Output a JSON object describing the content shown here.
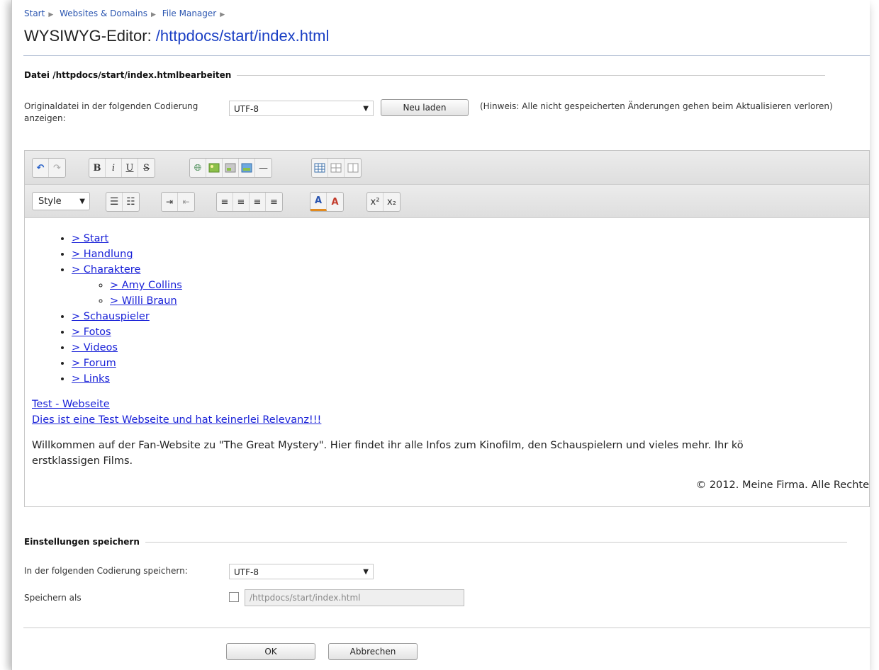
{
  "breadcrumb": [
    "Start",
    "Websites & Domains",
    "File Manager"
  ],
  "title": {
    "prefix": "WYSIWYG-Editor: ",
    "path": "/httpdocs/start/index.html"
  },
  "edit_section": {
    "title_prefix": "Datei /httpdocs/start/index.html ",
    "title_bold": "bearbeiten",
    "encoding_label": "Originaldatei in der folgenden Codierung anzeigen:",
    "encoding_value": "UTF-8",
    "reload_button": "Neu laden",
    "hint": "(Hinweis: Alle nicht gespeicherten Änderungen gehen beim Aktualisieren verloren)"
  },
  "toolbar": {
    "style_select": "Style"
  },
  "editor_content": {
    "nav": [
      {
        "label": "> Start"
      },
      {
        "label": "> Handlung"
      },
      {
        "label": "> Charaktere",
        "children": [
          "> Amy Collins",
          "> Willi Braun"
        ]
      },
      {
        "label": "> Schauspieler"
      },
      {
        "label": "> Fotos"
      },
      {
        "label": "> Videos"
      },
      {
        "label": "> Forum"
      },
      {
        "label": "> Links"
      }
    ],
    "link1": "Test - Webseite",
    "link2": "Dies ist eine Test Webseite und hat keinerlei Relevanz!!!",
    "welcome_line1": "Willkommen auf der Fan-Website zu \"The Great Mystery\". Hier findet ihr alle Infos zum Kinofilm, den Schauspielern und vieles mehr. Ihr kö",
    "welcome_line2": "erstklassigen Films.",
    "copyright": "© 2012. Meine Firma. Alle Rechte"
  },
  "save_section": {
    "title": "Einstellungen speichern",
    "encoding_label": "In der folgenden Codierung speichern:",
    "encoding_value": "UTF-8",
    "save_as_label": "Speichern als",
    "save_as_value": "/httpdocs/start/index.html"
  },
  "buttons": {
    "ok": "OK",
    "cancel": "Abbrechen"
  }
}
